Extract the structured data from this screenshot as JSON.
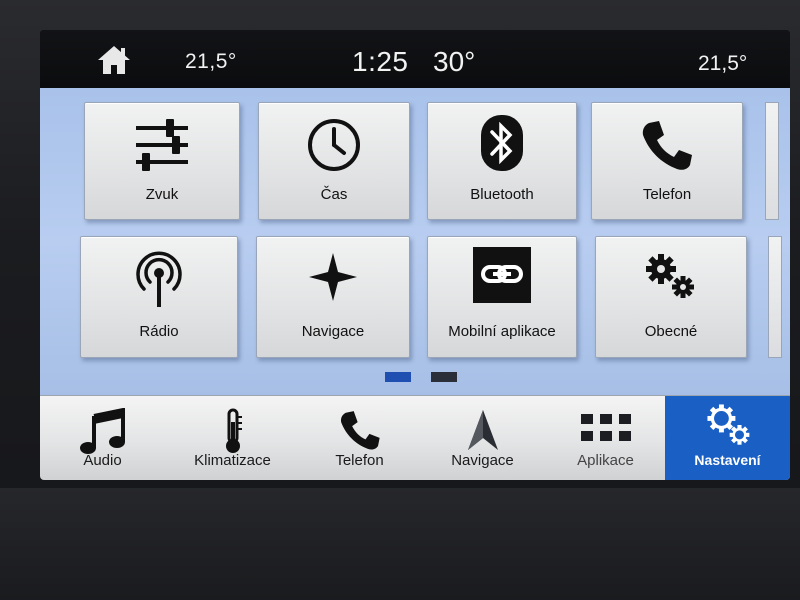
{
  "status_bar": {
    "temp_left": "21,5°",
    "time": "1:25",
    "outside_temp": "30°",
    "temp_right": "21,5°"
  },
  "tiles": [
    {
      "label": "Zvuk",
      "icon": "sliders-icon"
    },
    {
      "label": "Čas",
      "icon": "clock-icon"
    },
    {
      "label": "Bluetooth",
      "icon": "bluetooth-icon"
    },
    {
      "label": "Telefon",
      "icon": "phone-icon"
    },
    {
      "label": "Rádio",
      "icon": "radio-antenna-icon"
    },
    {
      "label": "Navigace",
      "icon": "compass-star-icon"
    },
    {
      "label": "Mobilní aplikace",
      "icon": "link-icon"
    },
    {
      "label": "Obecné",
      "icon": "gears-icon"
    }
  ],
  "pagination": {
    "current_page": 1,
    "total_pages": 2,
    "active_color": "#1f4fb0",
    "inactive_color": "#2a2e38"
  },
  "bottom_nav": [
    {
      "label": "Audio",
      "icon": "music-note-icon"
    },
    {
      "label": "Klimatizace",
      "icon": "thermometer-icon"
    },
    {
      "label": "Telefon",
      "icon": "phone-icon"
    },
    {
      "label": "Navigace",
      "icon": "nav-arrow-icon"
    },
    {
      "label": "Aplikace",
      "icon": "apps-grid-icon"
    },
    {
      "label": "Nastavení",
      "icon": "gears-icon",
      "active": true
    }
  ],
  "colors": {
    "active_tab": "#1a5fc4",
    "main_background": "#b0c7ee"
  }
}
